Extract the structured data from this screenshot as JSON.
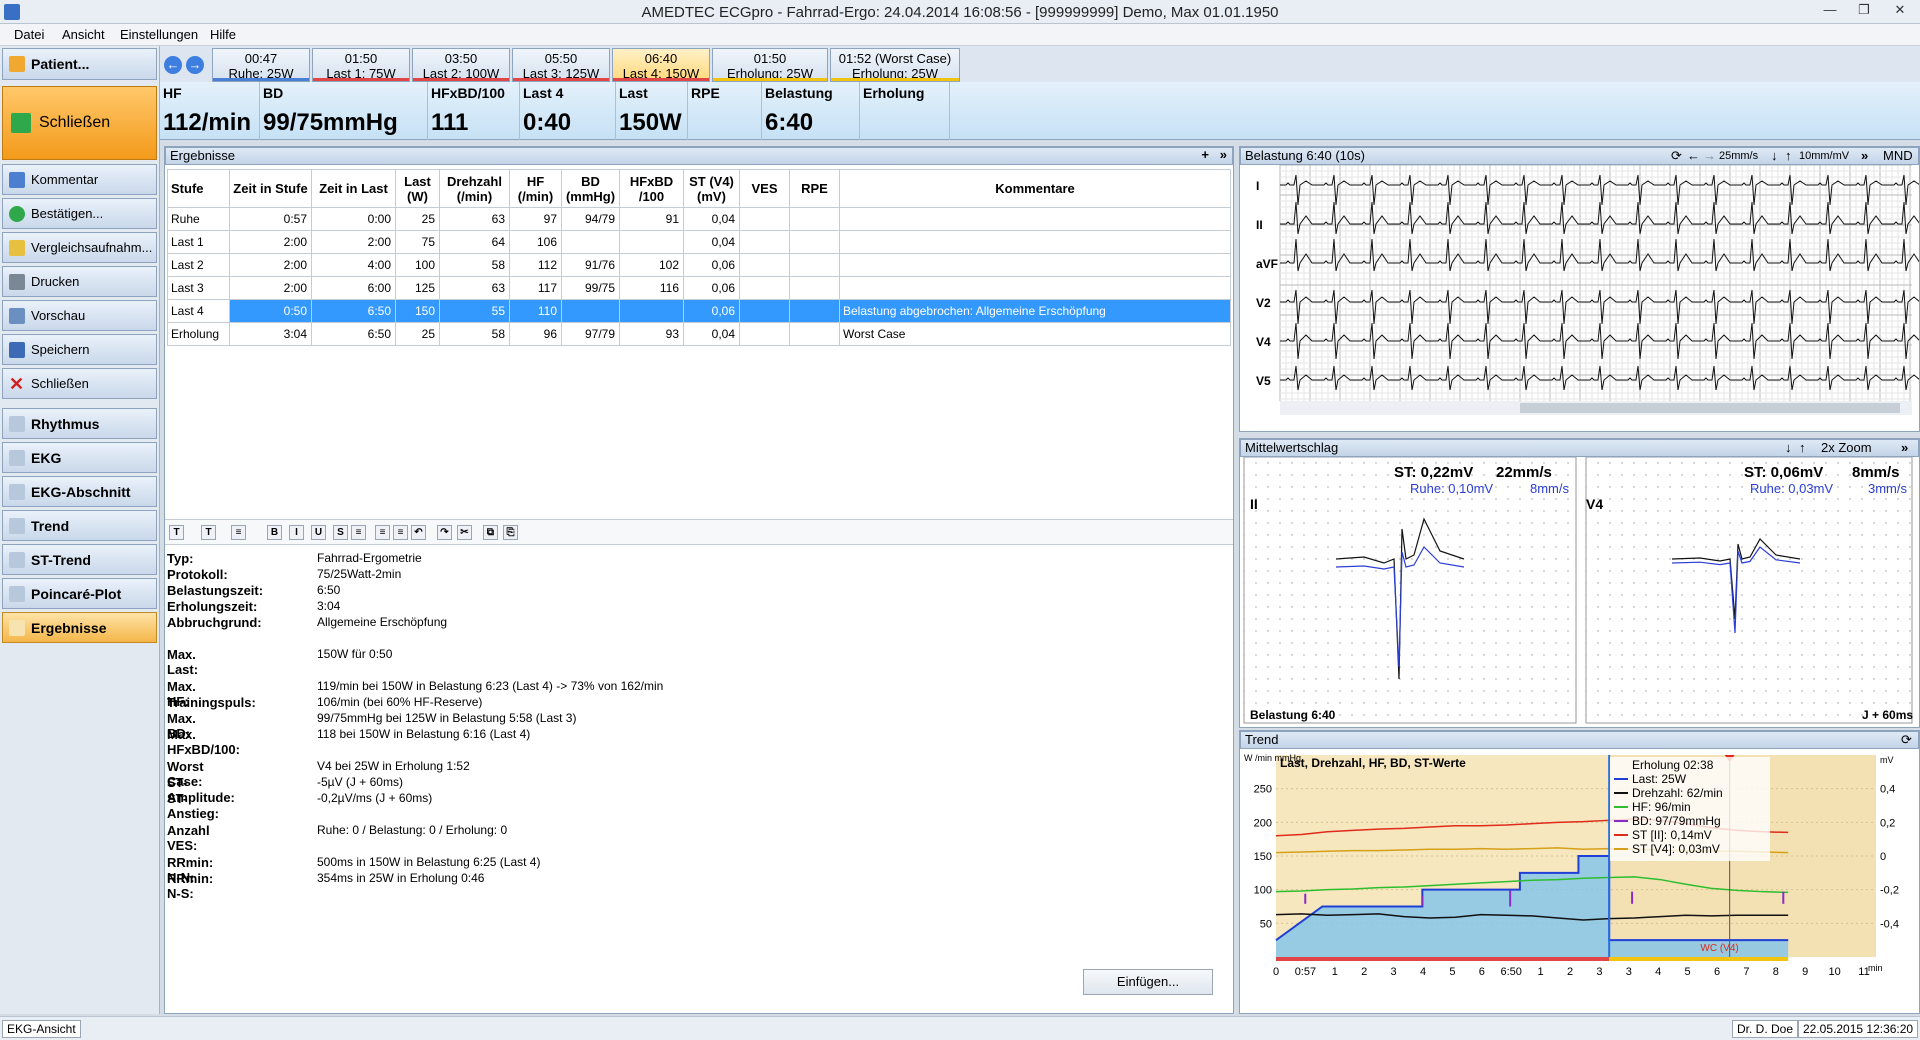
{
  "titlebar": {
    "title": "AMEDTEC ECGpro   -   Fahrrad-Ergo: 24.04.2014 16:08:56   -   [999999999] Demo, Max 01.01.1950",
    "min": "—",
    "restore": "❐",
    "close": "✕"
  },
  "menu": [
    "Datei",
    "Ansicht",
    "Einstellungen",
    "Hilfe"
  ],
  "left": {
    "patient": "Patient...",
    "close_big": "Schließen",
    "actions": [
      "Kommentar",
      "Bestätigen...",
      "Vergleichsaufnahm...",
      "Drucken",
      "Vorschau",
      "Speichern",
      "Schließen"
    ],
    "views": [
      "Rhythmus",
      "EKG",
      "EKG-Abschnitt",
      "Trend",
      "ST-Trend",
      "Poincaré-Plot",
      "Ergebnisse"
    ]
  },
  "tabs": [
    {
      "time": "00:47",
      "label": "Ruhe: 25W",
      "color": "#4a7fd6"
    },
    {
      "time": "01:50",
      "label": "Last 1: 75W",
      "color": "#e04646"
    },
    {
      "time": "03:50",
      "label": "Last 2: 100W",
      "color": "#e04646"
    },
    {
      "time": "05:50",
      "label": "Last 3: 125W",
      "color": "#e04646"
    },
    {
      "time": "06:40",
      "label": "Last 4: 150W",
      "color": "#e04646"
    },
    {
      "time": "01:50",
      "label": "Erholung: 25W",
      "color": "#f1c40f"
    },
    {
      "time": "01:52 (Worst Case)",
      "label": "Erholung: 25W",
      "color": "#f1c40f"
    }
  ],
  "summary": [
    {
      "label": "HF",
      "value": "112/min"
    },
    {
      "label": "BD",
      "value": "99/75mmHg"
    },
    {
      "label": "HFxBD/100",
      "value": "111"
    },
    {
      "label": "Last 4",
      "value": "0:40"
    },
    {
      "label": "Last",
      "value": "150W"
    },
    {
      "label": "RPE",
      "value": ""
    },
    {
      "label": "Belastung",
      "value": "6:40"
    },
    {
      "label": "Erholung",
      "value": ""
    }
  ],
  "results": {
    "title": "Ergebnisse",
    "headers": [
      "Stufe",
      "Zeit in Stufe",
      "Zeit in Last",
      "Last (W)",
      "Drehzahl (/min)",
      "HF (/min)",
      "BD (mmHg)",
      "HFxBD /100",
      "ST (V4) (mV)",
      "VES",
      "RPE",
      "Kommentare"
    ],
    "rows": [
      [
        "Ruhe",
        "0:57",
        "0:00",
        "25",
        "63",
        "97",
        "94/79",
        "91",
        "0,04",
        "",
        "",
        ""
      ],
      [
        "Last 1",
        "2:00",
        "2:00",
        "75",
        "64",
        "106",
        "",
        "",
        "0,04",
        "",
        "",
        ""
      ],
      [
        "Last 2",
        "2:00",
        "4:00",
        "100",
        "58",
        "112",
        "91/76",
        "102",
        "0,06",
        "",
        "",
        ""
      ],
      [
        "Last 3",
        "2:00",
        "6:00",
        "125",
        "63",
        "117",
        "99/75",
        "116",
        "0,06",
        "",
        "",
        ""
      ],
      [
        "Last 4",
        "0:50",
        "6:50",
        "150",
        "55",
        "110",
        "",
        "",
        "0,06",
        "",
        "",
        "Belastung abgebrochen: Allgemeine Erschöpfung"
      ],
      [
        "Erholung",
        "3:04",
        "6:50",
        "25",
        "58",
        "96",
        "97/79",
        "93",
        "0,04",
        "",
        "",
        "Worst Case"
      ]
    ],
    "selected_row": 4,
    "format_buttons": [
      "T",
      "T",
      "≡",
      "B",
      "I",
      "U",
      "S",
      "≡",
      "≡",
      "≡",
      "↶",
      "↷",
      "✂",
      "⧉",
      "⎘"
    ],
    "details": [
      {
        "k": "Typ:",
        "v": "Fahrrad-Ergometrie"
      },
      {
        "k": "Protokoll:",
        "v": "75/25Watt-2min"
      },
      {
        "k": "Belastungszeit:",
        "v": "6:50"
      },
      {
        "k": "Erholungszeit:",
        "v": "3:04"
      },
      {
        "k": "Abbruchgrund:",
        "v": "Allgemeine Erschöpfung"
      },
      {
        "k": "Max. Last:",
        "v": "150W für 0:50"
      },
      {
        "k": "Max. HF:",
        "v": "119/min bei 150W in Belastung 6:23 (Last 4) -> 73% von 162/min"
      },
      {
        "k": "Trainingspuls:",
        "v": "106/min (bei 60% HF-Reserve)"
      },
      {
        "k": "Max. BD:",
        "v": "99/75mmHg bei 125W in Belastung 5:58 (Last 3)"
      },
      {
        "k": "Max. HFxBD/100:",
        "v": "118 bei 150W in Belastung 6:16 (Last 4)"
      },
      {
        "k": "Worst Case:",
        "v": "V4 bei 25W in Erholung 1:52"
      },
      {
        "k": " ST-Amplitude:",
        "v": "-5µV (J + 60ms)"
      },
      {
        "k": " ST-Anstieg:",
        "v": "-0,2µV/ms (J + 60ms)"
      },
      {
        "k": "Anzahl VES:",
        "v": "Ruhe: 0 / Belastung: 0 / Erholung: 0"
      },
      {
        "k": "RRmin: N-N:",
        "v": "500ms in 150W in Belastung 6:25 (Last 4)"
      },
      {
        "k": "RRmin: N-S:",
        "v": "354ms in 25W in Erholung 0:46"
      }
    ],
    "insert_button": "Einfügen..."
  },
  "ecg": {
    "title": "Belastung 6:40 (10s)",
    "speed": "25mm/s",
    "gain": "10mm/mV",
    "mode": "MND",
    "leads": [
      "I",
      "II",
      "aVF",
      "V2",
      "V4",
      "V5"
    ]
  },
  "mean": {
    "title": "Mittelwertschlag",
    "zoom": "2x Zoom",
    "left": {
      "lead": "II",
      "st": "ST:  0,22mV",
      "speed": "22mm/s",
      "ruhe": "Ruhe: 0,10mV",
      "ruhe_speed": "8mm/s",
      "phase": "Belastung 6:40"
    },
    "right": {
      "lead": "V4",
      "st": "ST:  0,06mV",
      "speed": "8mm/s",
      "ruhe": "Ruhe: 0,03mV",
      "ruhe_speed": "3mm/s",
      "jpoint": "J + 60ms"
    }
  },
  "trend": {
    "title": "Trend",
    "chart_title": "Last, Drehzahl, HF, BD, ST-Werte",
    "yunit_left": "W\n/min\nmmHg",
    "yunit_right": "mV",
    "xunit": "min",
    "yticks_left": [
      "250",
      "200",
      "150",
      "100",
      "50"
    ],
    "yticks_right": [
      "0,4",
      "0,2",
      "0",
      "-0,2",
      "-0,4"
    ],
    "xticks": [
      "0",
      "0:57",
      "1",
      "2",
      "3",
      "4",
      "5",
      "6",
      "6:50",
      "1",
      "2",
      "3",
      "3",
      "4",
      "5",
      "6",
      "7",
      "8",
      "9",
      "10",
      "11"
    ],
    "legend": [
      {
        "name": "Erholung 02:38",
        "color": ""
      },
      {
        "name": "Last: 25W",
        "color": "#1f3fd6"
      },
      {
        "name": "Drehzahl: 62/min",
        "color": "#111111"
      },
      {
        "name": "HF: 96/min",
        "color": "#2ebd2e"
      },
      {
        "name": "BD: 97/79mmHg",
        "color": "#8a2bc8"
      },
      {
        "name": "ST [II]: 0,14mV",
        "color": "#e02a1a"
      },
      {
        "name": "ST [V4]: 0,03mV",
        "color": "#d6a019"
      }
    ],
    "wc_label": "WC (V4)"
  },
  "status": {
    "left": "EKG-Ansicht",
    "user": "Dr. D. Doe",
    "datetime": "22.05.2015 12:36:20"
  }
}
